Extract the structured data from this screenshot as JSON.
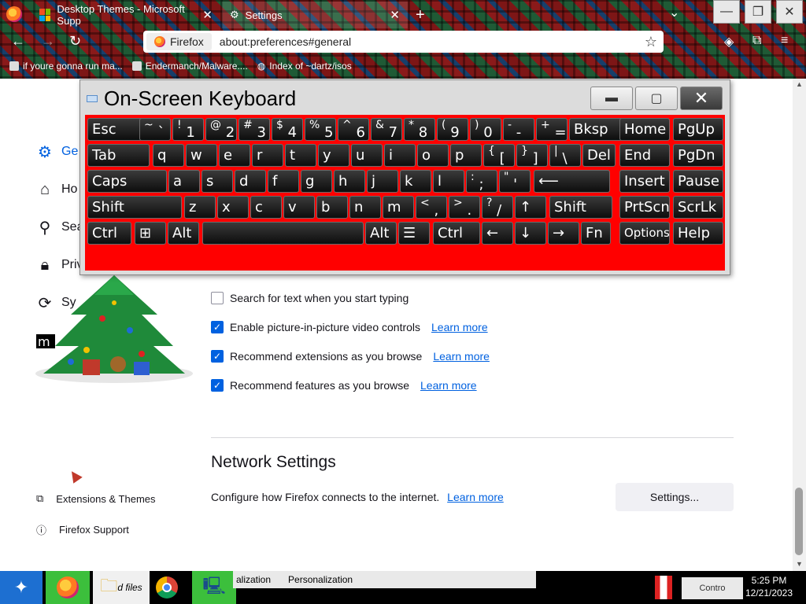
{
  "browser": {
    "tabs": [
      {
        "title": "Desktop Themes - Microsoft Supp",
        "active": false
      },
      {
        "title": "Settings",
        "active": true
      }
    ],
    "url_identity": "Firefox",
    "url": "about:preferences#general",
    "bookmarks": [
      {
        "label": "if youre gonna run ma..."
      },
      {
        "label": "Endermanch/Malware...."
      },
      {
        "label": "Index of ~dartz/isos"
      }
    ]
  },
  "sidebar": {
    "items": [
      {
        "label": "Ge",
        "icon": "gear-icon",
        "active": true
      },
      {
        "label": "Ho",
        "icon": "home-icon",
        "active": false
      },
      {
        "label": "Sea",
        "icon": "search-icon",
        "active": false
      },
      {
        "label": "Priv",
        "icon": "lock-icon",
        "active": false
      },
      {
        "label": "Sy",
        "icon": "sync-icon",
        "active": false
      }
    ],
    "footer": [
      {
        "label": "Extensions & Themes",
        "icon": "puzzle-icon"
      },
      {
        "label": "Firefox Support",
        "icon": "help-icon"
      }
    ],
    "tree_label": "m"
  },
  "content": {
    "checkboxes": [
      {
        "label": "Search for text when you start typing",
        "checked": false,
        "learn_more": ""
      },
      {
        "label": "Enable picture-in-picture video controls",
        "checked": true,
        "learn_more": "Learn more"
      },
      {
        "label": "Recommend extensions as you browse",
        "checked": true,
        "learn_more": "Learn more"
      },
      {
        "label": "Recommend features as you browse",
        "checked": true,
        "learn_more": "Learn more"
      }
    ],
    "network": {
      "title": "Network Settings",
      "description": "Configure how Firefox connects to the internet.",
      "learn_more": "Learn more",
      "button": "Settings..."
    }
  },
  "osk": {
    "title": "On-Screen Keyboard",
    "rows": [
      [
        {
          "label": "Esc"
        },
        {
          "sup": "~",
          "main": "`"
        },
        {
          "sup": "!",
          "main": "1"
        },
        {
          "sup": "@",
          "main": "2"
        },
        {
          "sup": "#",
          "main": "3"
        },
        {
          "sup": "$",
          "main": "4"
        },
        {
          "sup": "%",
          "main": "5"
        },
        {
          "sup": "^",
          "main": "6"
        },
        {
          "sup": "&",
          "main": "7"
        },
        {
          "sup": "*",
          "main": "8"
        },
        {
          "sup": "(",
          "main": "9"
        },
        {
          "sup": ")",
          "main": "0"
        },
        {
          "sup": "-",
          "main": "-"
        },
        {
          "sup": "+",
          "main": "="
        },
        {
          "label": "Bksp"
        },
        {
          "label": "Home"
        },
        {
          "label": "PgUp"
        }
      ],
      [
        {
          "label": "Tab"
        },
        {
          "label": "q"
        },
        {
          "label": "w"
        },
        {
          "label": "e"
        },
        {
          "label": "r"
        },
        {
          "label": "t"
        },
        {
          "label": "y"
        },
        {
          "label": "u"
        },
        {
          "label": "i"
        },
        {
          "label": "o"
        },
        {
          "label": "p"
        },
        {
          "sup": "{",
          "main": "["
        },
        {
          "sup": "}",
          "main": "]"
        },
        {
          "sup": "|",
          "main": "\\"
        },
        {
          "label": "Del"
        },
        {
          "label": "End"
        },
        {
          "label": "PgDn"
        }
      ],
      [
        {
          "label": "Caps"
        },
        {
          "label": "a"
        },
        {
          "label": "s"
        },
        {
          "label": "d"
        },
        {
          "label": "f"
        },
        {
          "label": "g"
        },
        {
          "label": "h"
        },
        {
          "label": "j"
        },
        {
          "label": "k"
        },
        {
          "label": "l"
        },
        {
          "sup": ":",
          "main": ";"
        },
        {
          "sup": "\"",
          "main": "'"
        },
        {
          "label": "⟵"
        },
        {
          "label": "Insert"
        },
        {
          "label": "Pause"
        }
      ],
      [
        {
          "label": "Shift"
        },
        {
          "label": "z"
        },
        {
          "label": "x"
        },
        {
          "label": "c"
        },
        {
          "label": "v"
        },
        {
          "label": "b"
        },
        {
          "label": "n"
        },
        {
          "label": "m"
        },
        {
          "sup": "<",
          "main": ","
        },
        {
          "sup": ">",
          "main": "."
        },
        {
          "sup": "?",
          "main": "/"
        },
        {
          "label": "↑"
        },
        {
          "label": "Shift"
        },
        {
          "label": "PrtScn"
        },
        {
          "label": "ScrLk"
        }
      ],
      [
        {
          "label": "Ctrl"
        },
        {
          "label": "⊞"
        },
        {
          "label": "Alt"
        },
        {
          "label": ""
        },
        {
          "label": "Alt"
        },
        {
          "label": "☰"
        },
        {
          "label": "Ctrl"
        },
        {
          "label": "←"
        },
        {
          "label": "↓"
        },
        {
          "label": "→"
        },
        {
          "label": "Fn"
        },
        {
          "label": "Options"
        },
        {
          "label": "Help"
        }
      ]
    ]
  },
  "taskbar": {
    "label_box_text_1": "alization",
    "label_box_text_2": "Personalization",
    "files_label": "d files",
    "tray_text": "Contro",
    "time": "5:25 PM",
    "date": "12/21/2023"
  }
}
